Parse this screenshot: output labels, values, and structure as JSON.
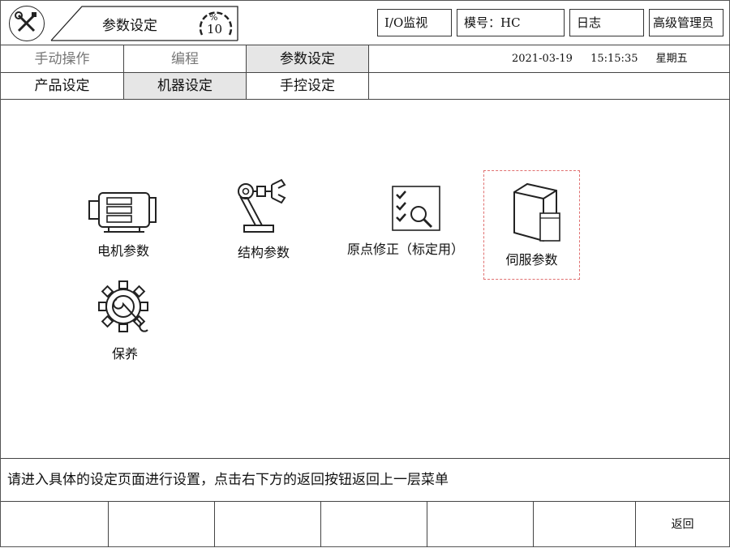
{
  "header": {
    "title": "参数设定",
    "speed_percent": "%",
    "speed_value": "10",
    "io_monitor": "I/O监视",
    "mold": "模号：HC",
    "log": "日志",
    "user": "高级管理员"
  },
  "main_tabs": [
    "手动操作",
    "编程",
    "参数设定"
  ],
  "datetime": {
    "date": "2021-03-19",
    "time": "15:15:35",
    "weekday": "星期五"
  },
  "sub_tabs": [
    "产品设定",
    "机器设定",
    "手控设定"
  ],
  "items": [
    {
      "label": "电机参数",
      "icon": "motor-icon"
    },
    {
      "label": "结构参数",
      "icon": "robot-arm-icon"
    },
    {
      "label": "原点修正（标定用）",
      "icon": "checklist-magnifier-icon"
    },
    {
      "label": "伺服参数",
      "icon": "servo-drive-icon"
    },
    {
      "label": "保养",
      "icon": "gear-wrench-icon"
    }
  ],
  "status_message": "请进入具体的设定页面进行设置，点击右下方的返回按钮返回上一层菜单",
  "footer": {
    "back": "返回"
  }
}
